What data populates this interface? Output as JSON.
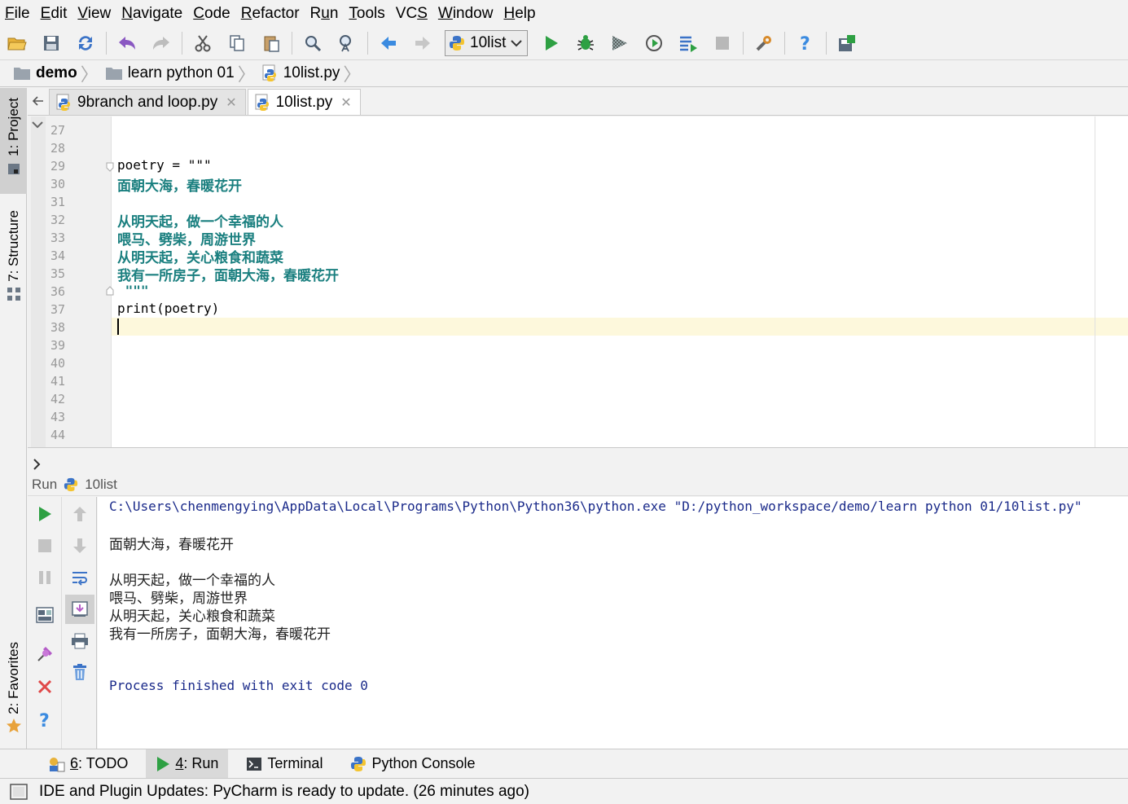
{
  "menu": [
    "File",
    "Edit",
    "View",
    "Navigate",
    "Code",
    "Refactor",
    "Run",
    "Tools",
    "VCS",
    "Window",
    "Help"
  ],
  "menu_mnemonic": [
    "F",
    "E",
    "V",
    "N",
    "C",
    "R",
    "u",
    "T",
    "S",
    "W",
    "H"
  ],
  "toolbar": {
    "run_config": "10list"
  },
  "breadcrumb": {
    "project": "demo",
    "folder": "learn python 01",
    "file": "10list.py"
  },
  "side_tabs": {
    "project": "1: Project",
    "structure": "7: Structure",
    "favorites": "2: Favorites"
  },
  "editor_tabs": [
    {
      "label": "9branch and loop.py",
      "active": false
    },
    {
      "label": "10list.py",
      "active": true
    }
  ],
  "editor": {
    "line_numbers": [
      "27",
      "28",
      "29",
      "30",
      "31",
      "32",
      "33",
      "34",
      "35",
      "36",
      "37",
      "38",
      "39",
      "40",
      "41",
      "42",
      "43",
      "44"
    ],
    "lines": {
      "l29": "poetry = \"\"\"",
      "l30": "面朝大海，春暖花开",
      "l32": "从明天起，做一个幸福的人",
      "l33": "喂马、劈柴，周游世界",
      "l34": "从明天起，关心粮食和蔬菜",
      "l35": "我有一所房子，面朝大海，春暖花开",
      "l36": " \"\"\"",
      "l37": "print(poetry)"
    },
    "current_line": "38"
  },
  "run_panel": {
    "title": "Run",
    "config": "10list",
    "command": "C:\\Users\\chenmengying\\AppData\\Local\\Programs\\Python\\Python36\\python.exe \"D:/python_workspace/demo/learn python 01/10list.py\"",
    "output": [
      "面朝大海，春暖花开",
      "从明天起，做一个幸福的人",
      "喂马、劈柴，周游世界",
      "从明天起，关心粮食和蔬菜",
      "我有一所房子，面朝大海，春暖花开"
    ],
    "exit_message": "Process finished with exit code 0"
  },
  "bottom_tabs": [
    {
      "num": "6",
      "label": ": TODO",
      "active": false
    },
    {
      "num": "4",
      "label": ": Run",
      "active": true
    },
    {
      "num": "",
      "label": "Terminal",
      "active": false
    },
    {
      "num": "",
      "label": "Python Console",
      "active": false
    }
  ],
  "status": {
    "message": "IDE and Plugin Updates: PyCharm is ready to update. (26 minutes ago)"
  },
  "colors": {
    "run_green": "#2ea043",
    "string_teal": "#1a7f7f",
    "console_blue": "#1a2a8a",
    "current_line": "#fdf8dc"
  }
}
